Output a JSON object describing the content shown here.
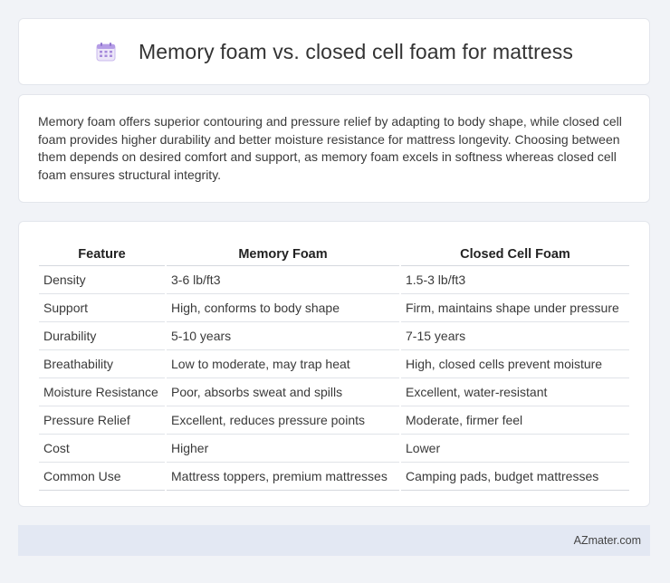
{
  "header": {
    "icon": "calendar-icon",
    "title": "Memory foam vs. closed cell foam for mattress"
  },
  "summary": {
    "text": "Memory foam offers superior contouring and pressure relief by adapting to body shape, while closed cell foam provides higher durability and better moisture resistance for mattress longevity. Choosing between them depends on desired comfort and support, as memory foam excels in softness whereas closed cell foam ensures structural integrity."
  },
  "table": {
    "headers": [
      "Feature",
      "Memory Foam",
      "Closed Cell Foam"
    ],
    "rows": [
      [
        "Density",
        "3-6 lb/ft3",
        "1.5-3 lb/ft3"
      ],
      [
        "Support",
        "High, conforms to body shape",
        "Firm, maintains shape under pressure"
      ],
      [
        "Durability",
        "5-10 years",
        "7-15 years"
      ],
      [
        "Breathability",
        "Low to moderate, may trap heat",
        "High, closed cells prevent moisture"
      ],
      [
        "Moisture Resistance",
        "Poor, absorbs sweat and spills",
        "Excellent, water-resistant"
      ],
      [
        "Pressure Relief",
        "Excellent, reduces pressure points",
        "Moderate, firmer feel"
      ],
      [
        "Cost",
        "Higher",
        "Lower"
      ],
      [
        "Common Use",
        "Mattress toppers, premium mattresses",
        "Camping pads, budget mattresses"
      ]
    ]
  },
  "footer": {
    "brand": "AZmater.com"
  },
  "colors": {
    "background": "#f1f3f7",
    "card": "#ffffff",
    "footer": "#e3e8f3",
    "icon_accent": "#a78bdb"
  }
}
